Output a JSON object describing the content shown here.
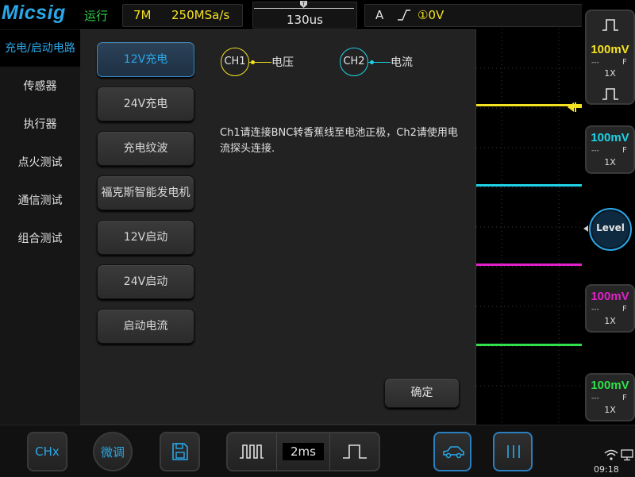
{
  "topbar": {
    "logo": "Micsig",
    "run_status": "运行",
    "memory_depth": "7M",
    "sample_rate": "250MSa/s",
    "timebase_position": "130us",
    "trigger_source": "A",
    "trigger_edge_icon": "rising-edge-icon",
    "trigger_level": "①0V"
  },
  "channels": [
    {
      "id": "CH1",
      "scale": "100mV",
      "coupling": "---",
      "bw": "F",
      "probe": "1X",
      "color": "#f4e221"
    },
    {
      "id": "CH2",
      "scale": "100mV",
      "coupling": "---",
      "bw": "F",
      "probe": "1X",
      "color": "#1ed2e6"
    },
    {
      "id": "CH3",
      "scale": "100mV",
      "coupling": "---",
      "bw": "F",
      "probe": "1X",
      "color": "#e021c8"
    },
    {
      "id": "CH4",
      "scale": "100mV",
      "coupling": "---",
      "bw": "F",
      "probe": "1X",
      "color": "#2ee04a"
    }
  ],
  "level_button": "Level",
  "sidebar": {
    "items": [
      {
        "label": "充电/启动电路",
        "active": true
      },
      {
        "label": "传感器"
      },
      {
        "label": "执行器"
      },
      {
        "label": "点火测试"
      },
      {
        "label": "通信测试"
      },
      {
        "label": "组合测试"
      }
    ]
  },
  "submenu": {
    "items": [
      {
        "label": "12V充电",
        "active": true
      },
      {
        "label": "24V充电"
      },
      {
        "label": "充电纹波"
      },
      {
        "label": "福克斯智能发电机"
      },
      {
        "label": "12V启动"
      },
      {
        "label": "24V启动"
      },
      {
        "label": "启动电流"
      }
    ]
  },
  "detail": {
    "ch1_label": "CH1",
    "ch1_meaning": "电压",
    "ch2_label": "CH2",
    "ch2_meaning": "电流",
    "instruction": "Ch1请连接BNC转香蕉线至电池正极，Ch2请使用电流探头连接.",
    "confirm": "确定"
  },
  "bottombar": {
    "chx": "CHx",
    "fine": "微调",
    "timebase": "2ms",
    "clock": "09:18"
  },
  "colors": {
    "accent": "#2aa8e8",
    "ch1": "#f4e221",
    "ch2": "#1ed2e6",
    "ch3": "#e021c8",
    "ch4": "#2ee04a",
    "run": "#2ed14a"
  }
}
